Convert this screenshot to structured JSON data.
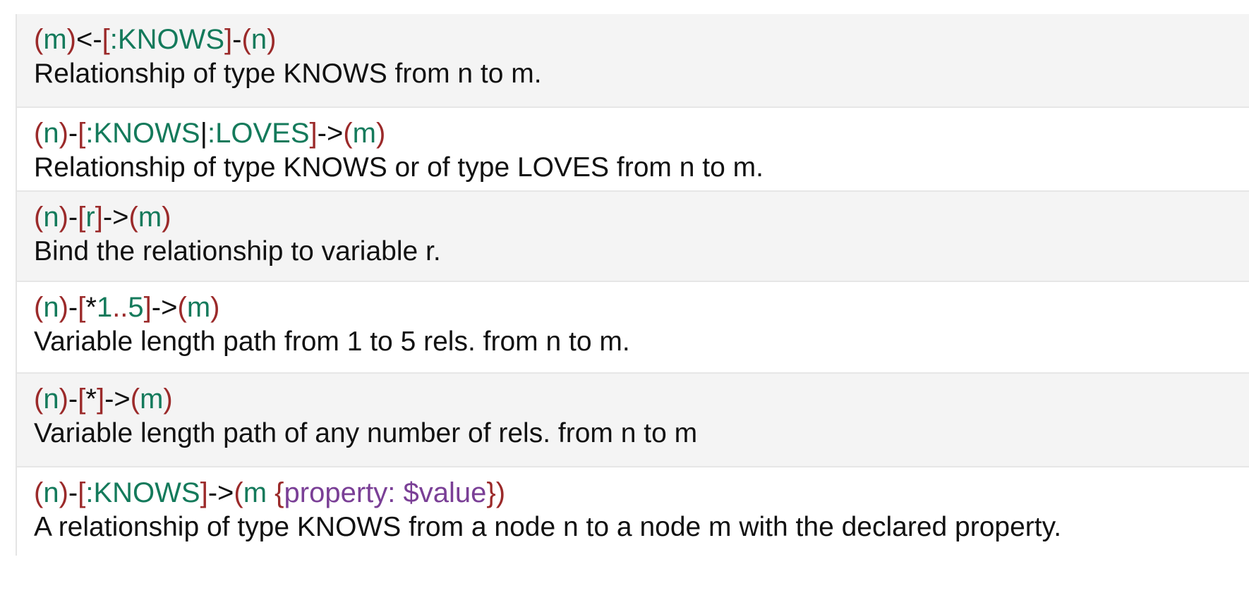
{
  "colors": {
    "paren": "#9b2a2a",
    "identifier": "#147a5b",
    "operator": "#111111",
    "property": "#7a3f96",
    "row_shade": "#f4f4f4"
  },
  "rows": [
    {
      "code": [
        {
          "t": "(",
          "c": "p"
        },
        {
          "t": "m",
          "c": "i"
        },
        {
          "t": ")",
          "c": "p"
        },
        {
          "t": "<-",
          "c": "o"
        },
        {
          "t": "[",
          "c": "p"
        },
        {
          "t": ":KNOWS",
          "c": "i"
        },
        {
          "t": "]",
          "c": "p"
        },
        {
          "t": "-",
          "c": "o"
        },
        {
          "t": "(",
          "c": "p"
        },
        {
          "t": "n",
          "c": "i"
        },
        {
          "t": ")",
          "c": "p"
        }
      ],
      "description": "Relationship of type KNOWS from n to m."
    },
    {
      "code": [
        {
          "t": "(",
          "c": "p"
        },
        {
          "t": "n",
          "c": "i"
        },
        {
          "t": ")",
          "c": "p"
        },
        {
          "t": "-",
          "c": "o"
        },
        {
          "t": "[",
          "c": "p"
        },
        {
          "t": ":KNOWS",
          "c": "i"
        },
        {
          "t": "|",
          "c": "o"
        },
        {
          "t": ":LOVES",
          "c": "i"
        },
        {
          "t": "]",
          "c": "p"
        },
        {
          "t": "->",
          "c": "o"
        },
        {
          "t": "(",
          "c": "p"
        },
        {
          "t": "m",
          "c": "i"
        },
        {
          "t": ")",
          "c": "p"
        }
      ],
      "description": "Relationship of type KNOWS or of type LOVES from n to m."
    },
    {
      "code": [
        {
          "t": "(",
          "c": "p"
        },
        {
          "t": "n",
          "c": "i"
        },
        {
          "t": ")",
          "c": "p"
        },
        {
          "t": "-",
          "c": "o"
        },
        {
          "t": "[",
          "c": "p"
        },
        {
          "t": "r",
          "c": "i"
        },
        {
          "t": "]",
          "c": "p"
        },
        {
          "t": "->",
          "c": "o"
        },
        {
          "t": "(",
          "c": "p"
        },
        {
          "t": "m",
          "c": "i"
        },
        {
          "t": ")",
          "c": "p"
        }
      ],
      "description": "Bind the relationship to variable r."
    },
    {
      "code": [
        {
          "t": "(",
          "c": "p"
        },
        {
          "t": "n",
          "c": "i"
        },
        {
          "t": ")",
          "c": "p"
        },
        {
          "t": "-",
          "c": "o"
        },
        {
          "t": "[",
          "c": "p"
        },
        {
          "t": "*",
          "c": "o"
        },
        {
          "t": "1",
          "c": "i"
        },
        {
          "t": "..",
          "c": "p"
        },
        {
          "t": "5",
          "c": "i"
        },
        {
          "t": "]",
          "c": "p"
        },
        {
          "t": "->",
          "c": "o"
        },
        {
          "t": "(",
          "c": "p"
        },
        {
          "t": "m",
          "c": "i"
        },
        {
          "t": ")",
          "c": "p"
        }
      ],
      "description": "Variable length path from 1 to 5 rels. from n to m."
    },
    {
      "code": [
        {
          "t": "(",
          "c": "p"
        },
        {
          "t": "n",
          "c": "i"
        },
        {
          "t": ")",
          "c": "p"
        },
        {
          "t": "-",
          "c": "o"
        },
        {
          "t": "[",
          "c": "p"
        },
        {
          "t": "*",
          "c": "o"
        },
        {
          "t": "]",
          "c": "p"
        },
        {
          "t": "->",
          "c": "o"
        },
        {
          "t": "(",
          "c": "p"
        },
        {
          "t": "m",
          "c": "i"
        },
        {
          "t": ")",
          "c": "p"
        }
      ],
      "description": "Variable length path of any number of rels. from n to m"
    },
    {
      "code": [
        {
          "t": "(",
          "c": "p"
        },
        {
          "t": "n",
          "c": "i"
        },
        {
          "t": ")",
          "c": "p"
        },
        {
          "t": "-",
          "c": "o"
        },
        {
          "t": "[",
          "c": "p"
        },
        {
          "t": ":KNOWS",
          "c": "i"
        },
        {
          "t": "]",
          "c": "p"
        },
        {
          "t": "->",
          "c": "o"
        },
        {
          "t": "(",
          "c": "p"
        },
        {
          "t": "m ",
          "c": "i"
        },
        {
          "t": "{",
          "c": "p"
        },
        {
          "t": "property: $value",
          "c": "v"
        },
        {
          "t": "}",
          "c": "p"
        },
        {
          "t": ")",
          "c": "p"
        }
      ],
      "description": "A relationship of type KNOWS from a node n to a node m with the declared property."
    }
  ]
}
